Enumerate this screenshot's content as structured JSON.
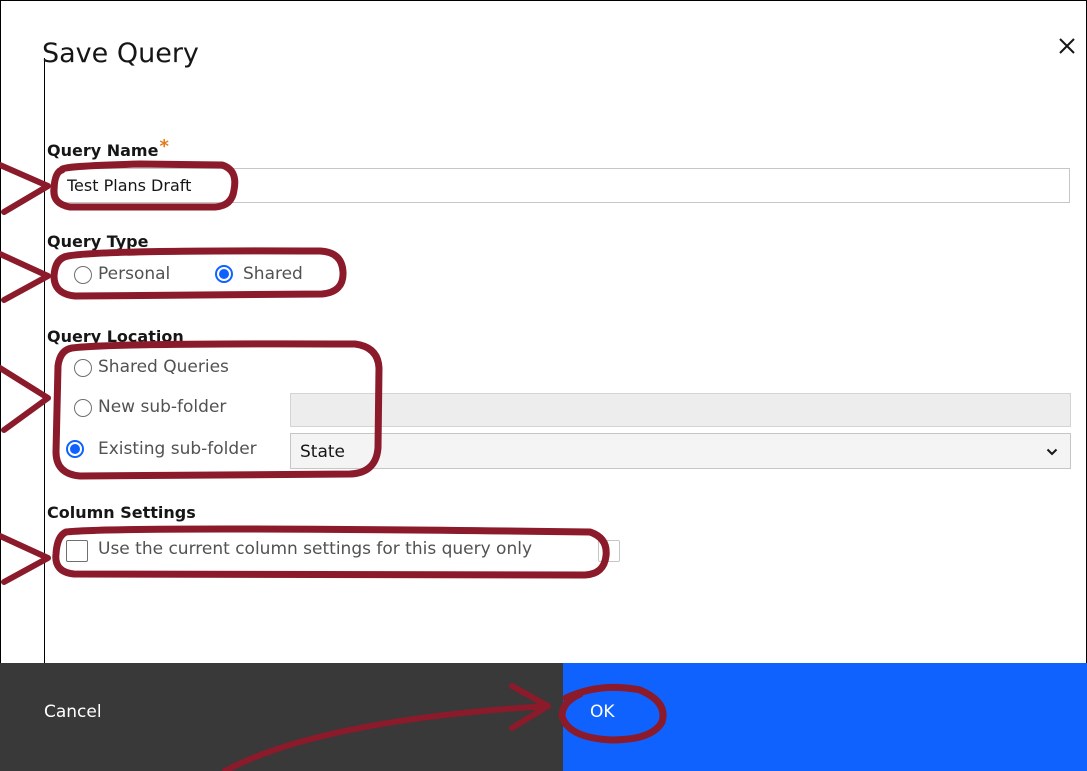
{
  "dialog": {
    "title": "Save Query",
    "close_icon": "close-icon"
  },
  "query_name": {
    "label": "Query Name",
    "required_mark": "*",
    "value": "Test Plans Draft"
  },
  "query_type": {
    "label": "Query Type",
    "options": [
      {
        "label": "Personal",
        "checked": false
      },
      {
        "label": "Shared",
        "checked": true
      }
    ]
  },
  "query_location": {
    "label": "Query Location",
    "options": [
      {
        "label": "Shared Queries",
        "checked": false
      },
      {
        "label": "New sub-folder",
        "checked": false
      },
      {
        "label": "Existing sub-folder",
        "checked": true
      }
    ],
    "new_subfolder_value": "",
    "existing_subfolder_selected": "State"
  },
  "column_settings": {
    "label": "Column Settings",
    "checkbox_label": "Use the current column settings for this query only",
    "checked": false
  },
  "footer": {
    "cancel_label": "Cancel",
    "ok_label": "OK"
  },
  "colors": {
    "primary": "#0f62fe",
    "secondary_button": "#393939",
    "required": "#e37c17",
    "annotation": "#8b1a2b"
  }
}
